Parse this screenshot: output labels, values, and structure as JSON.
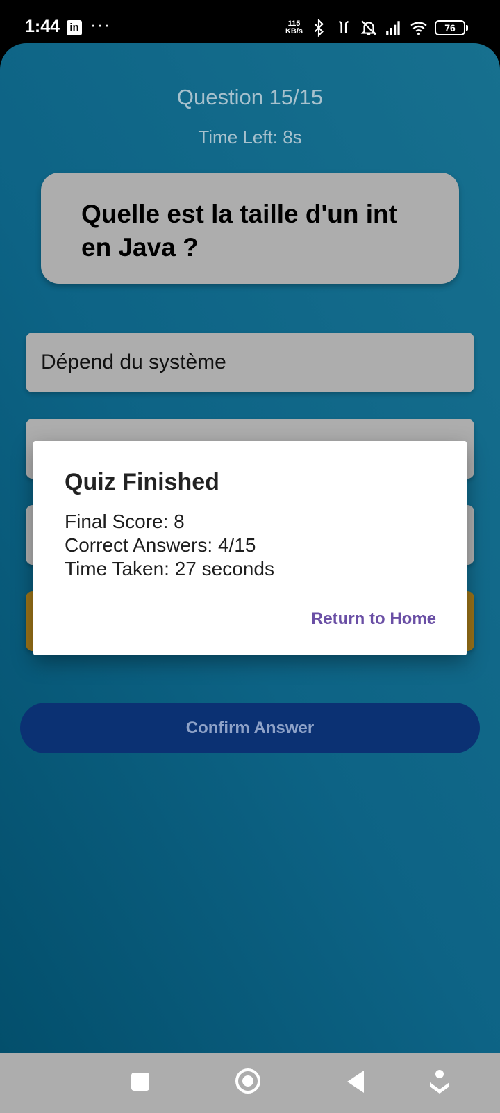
{
  "status_bar": {
    "time": "1:44",
    "app_icon": "linkedin-icon",
    "app_icon_text": "in",
    "more": "···",
    "net_speed_value": "115",
    "net_speed_unit": "KB/s",
    "battery": "76"
  },
  "quiz": {
    "counter": "Question 15/15",
    "time_left": "Time Left: 8s",
    "question": "Quelle est la taille d'un int en Java ?",
    "options": [
      {
        "label": "Dépend du système",
        "selected": false
      },
      {
        "label": "",
        "selected": false
      },
      {
        "label": "",
        "selected": false
      },
      {
        "label": "",
        "selected": true
      }
    ],
    "confirm_label": "Confirm Answer"
  },
  "dialog": {
    "title": "Quiz Finished",
    "final_score": "Final Score: 8",
    "correct_answers": "Correct Answers: 4/15",
    "time_taken": "Time Taken: 27 seconds",
    "action_label": "Return to Home"
  },
  "colors": {
    "background_gradient_start": "#034f6c",
    "background_gradient_end": "#17708f",
    "card_gray": "#adadad",
    "selected_option": "#9b7318",
    "confirm_button": "#0b3173",
    "dialog_action": "#6a4fa5"
  }
}
